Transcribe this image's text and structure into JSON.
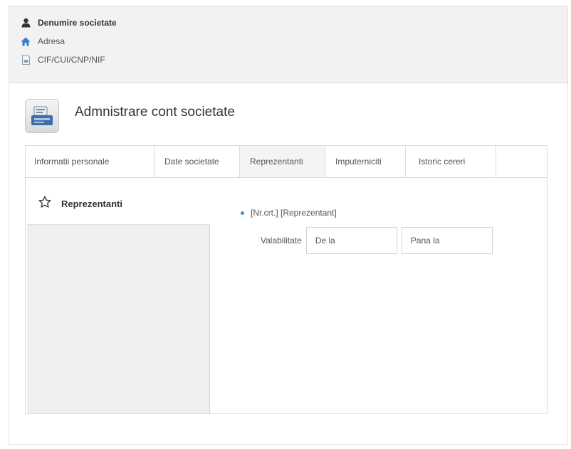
{
  "company": {
    "name": "Denumire societate",
    "address": "Adresa",
    "fiscal_id": "CIF/CUI/CNP/NIF"
  },
  "page": {
    "title": "Admnistrare cont societate"
  },
  "tabs": [
    {
      "label": "Informatii personale",
      "active": false
    },
    {
      "label": "Date societate",
      "active": false
    },
    {
      "label": "Reprezentanti",
      "active": true
    },
    {
      "label": "Imputerniciti",
      "active": false
    },
    {
      "label": "Istoric cereri",
      "active": false
    }
  ],
  "sidebar": {
    "items": [
      {
        "label": "Reprezentanti",
        "icon": "star-outline-icon"
      }
    ]
  },
  "representative": {
    "entry_label": "[Nr.crt.] [Reprezentant]",
    "validity_label": "Valabilitate",
    "from_placeholder": "De la",
    "to_placeholder": "Pana la"
  },
  "colors": {
    "header_bg": "#f2f2f2",
    "sidebar_bg": "#efefef",
    "bullet": "#3a8fd0",
    "home_icon": "#3a7fc4"
  }
}
